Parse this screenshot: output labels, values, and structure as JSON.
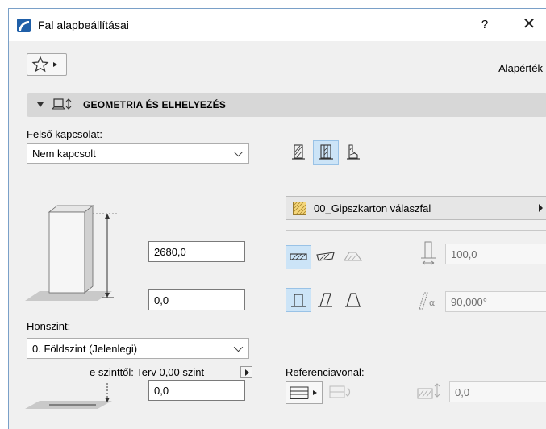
{
  "window": {
    "title": "Fal alapbeállításai",
    "help_label": "?",
    "close_label": "✕"
  },
  "toolbar": {
    "default_label": "Alapérték"
  },
  "section": {
    "title": "GEOMETRIA ÉS ELHELYEZÉS"
  },
  "top_link": {
    "label": "Felső kapcsolat:",
    "value": "Nem kapcsolt"
  },
  "height_field": {
    "value": "2680,0"
  },
  "bottom_offset_field": {
    "value": "0,0"
  },
  "home_story": {
    "label": "Honszint:",
    "value": "0. Földszint (Jelenlegi)"
  },
  "offset_from_story": {
    "label": "e szinttől: Terv 0,00 szint",
    "value": "0,0"
  },
  "material": {
    "name": "00_Gipszkarton válaszfal",
    "swatch_color": "#f5d67a"
  },
  "thickness_field": {
    "value": "100,0"
  },
  "angle_field": {
    "value": "90,000°"
  },
  "reference_line": {
    "label": "Referenciavonal:",
    "value": "0,0"
  },
  "colors": {
    "selected_bg": "#cce4f7",
    "header_bg": "#d7d7d7",
    "accent": "#1f5fa8"
  }
}
